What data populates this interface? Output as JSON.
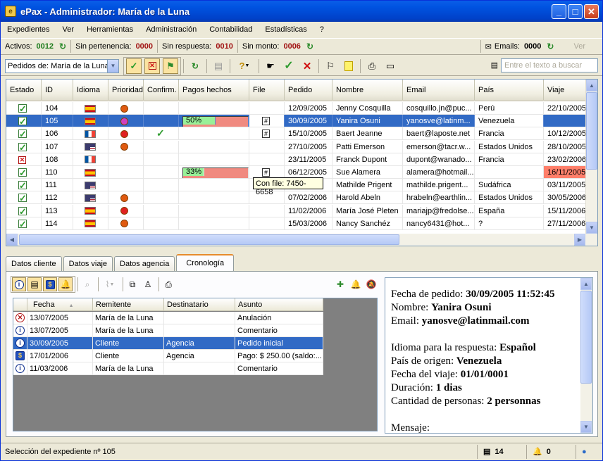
{
  "window": {
    "title": "ePax - Administrador: María de la Luna"
  },
  "menu": [
    "Expedientes",
    "Ver",
    "Herramientas",
    "Administración",
    "Contabilidad",
    "Estadísticas",
    "?"
  ],
  "counters": {
    "activos_label": "Activos:",
    "activos_value": "0012",
    "sin_pertenencia_label": "Sin pertenencia:",
    "sin_pertenencia_value": "0000",
    "sin_respuesta_label": "Sin respuesta:",
    "sin_respuesta_value": "0010",
    "sin_monto_label": "Sin monto:",
    "sin_monto_value": "0006",
    "emails_label": "Emails:",
    "emails_value": "0000",
    "ver_label": "Ver"
  },
  "toolbar": {
    "pedidos_select": "Pedidos de: María de la Luna",
    "search_placeholder": "Entre el texto a buscar"
  },
  "grid": {
    "columns": [
      "Estado",
      "ID",
      "Idioma",
      "Prioridad",
      "Confirm.",
      "Pagos hechos",
      "File",
      "Pedido",
      "Nombre",
      "Email",
      "País",
      "Viaje"
    ],
    "rows": [
      {
        "estado": "ok",
        "id": "104",
        "lang": "es",
        "prio": "a",
        "confirm": false,
        "pago": null,
        "file": false,
        "pedido": "12/09/2005",
        "nombre": "Jenny Cosquilla",
        "email": "cosquillo.jn@puc...",
        "pais": "Perú",
        "viaje": "22/10/2005"
      },
      {
        "estado": "ok",
        "id": "105",
        "lang": "es",
        "prio": "b",
        "confirm": false,
        "pago": 0.5,
        "pago_label": "50%",
        "file": true,
        "pedido": "30/09/2005",
        "nombre": "Yanira Osuni",
        "email": "yanosve@latinm...",
        "pais": "Venezuela",
        "viaje": ""
      },
      {
        "estado": "ok",
        "id": "106",
        "lang": "fr",
        "prio": "c",
        "confirm": true,
        "pago": null,
        "file": true,
        "pedido": "15/10/2005",
        "nombre": "Baert Jeanne",
        "email": "baert@laposte.net",
        "pais": "Francia",
        "viaje": "10/12/2005"
      },
      {
        "estado": "ok",
        "id": "107",
        "lang": "us",
        "prio": "a",
        "confirm": false,
        "pago": null,
        "file": false,
        "pedido": "27/10/2005",
        "nombre": "Patti Emerson",
        "email": "emerson@tacr.w...",
        "pais": "Estados Unidos",
        "viaje": "28/10/2005"
      },
      {
        "estado": "x",
        "id": "108",
        "lang": "fr",
        "prio": "",
        "confirm": false,
        "pago": null,
        "file": false,
        "pedido": "23/11/2005",
        "nombre": "Franck Dupont",
        "email": "dupont@wanado...",
        "pais": "Francia",
        "viaje": "23/02/2006"
      },
      {
        "estado": "ok",
        "id": "110",
        "lang": "es",
        "prio": "",
        "confirm": false,
        "pago": 0.33,
        "pago_label": "33%",
        "file": true,
        "pedido": "06/12/2005",
        "nombre": "Sue Alamera",
        "email": "alamera@hotmail...",
        "pais": "",
        "viaje": "16/11/2005",
        "viaje_hl": true
      },
      {
        "estado": "ok",
        "id": "111",
        "lang": "us",
        "prio": "",
        "confirm": false,
        "pago": null,
        "file": false,
        "pedido": "",
        "nombre": "Mathilde Prigent",
        "email": "mathilde.prigent...",
        "pais": "Sudáfrica",
        "viaje": "03/11/2005"
      },
      {
        "estado": "ok",
        "id": "112",
        "lang": "us",
        "prio": "a",
        "confirm": false,
        "pago": null,
        "file": false,
        "pedido": "07/02/2006",
        "nombre": "Harold Abeln",
        "email": "hrabeln@earthlin...",
        "pais": "Estados Unidos",
        "viaje": "30/05/2006"
      },
      {
        "estado": "ok",
        "id": "113",
        "lang": "es",
        "prio": "c",
        "confirm": false,
        "pago": null,
        "file": false,
        "pedido": "11/02/2006",
        "nombre": "María José Pleten",
        "email": "mariajp@fredolse...",
        "pais": "España",
        "viaje": "15/11/2006"
      },
      {
        "estado": "ok",
        "id": "114",
        "lang": "es",
        "prio": "a",
        "confirm": false,
        "pago": null,
        "file": false,
        "pedido": "15/03/2006",
        "nombre": "Nancy Sanchéz",
        "email": "nancy6431@hot...",
        "pais": "?",
        "viaje": "27/11/2006"
      }
    ],
    "tooltip": "Con file: 7450-6658"
  },
  "tabs": [
    "Datos cliente",
    "Datos viaje",
    "Datos agencia",
    "Cronología"
  ],
  "chrono": {
    "columns": [
      "Fecha",
      "Remitente",
      "Destinatario",
      "Asunto"
    ],
    "rows": [
      {
        "icon": "x",
        "fecha": "13/07/2005",
        "remitente": "María de la Luna",
        "destinatario": "",
        "asunto": "Anulación"
      },
      {
        "icon": "i",
        "fecha": "13/07/2005",
        "remitente": "María de la Luna",
        "destinatario": "",
        "asunto": "Comentario"
      },
      {
        "icon": "i",
        "fecha": "30/09/2005",
        "remitente": "Cliente",
        "destinatario": "Agencia",
        "asunto": "Pedido inicial",
        "sel": true
      },
      {
        "icon": "d",
        "fecha": "17/01/2006",
        "remitente": "Cliente",
        "destinatario": "Agencia",
        "asunto": "Pago: $ 250.00 (saldo:..."
      },
      {
        "icon": "i",
        "fecha": "11/03/2006",
        "remitente": "María de la Luna",
        "destinatario": "",
        "asunto": "Comentario"
      }
    ]
  },
  "detail": {
    "lines": [
      {
        "label": "Fecha de pedido: ",
        "value": "30/09/2005 11:52:45"
      },
      {
        "label": "Nombre: ",
        "value": "Yanira Osuni"
      },
      {
        "label": "Email: ",
        "value": "yanosve@latinmail.com"
      },
      {
        "label": "",
        "value": ""
      },
      {
        "label": "Idioma para la respuesta: ",
        "value": "Español"
      },
      {
        "label": "País de origen: ",
        "value": "Venezuela"
      },
      {
        "label": "Fecha del viaje: ",
        "value": "01/01/0001"
      },
      {
        "label": "Duración: ",
        "value": "1 dias"
      },
      {
        "label": "Cantidad de personas: ",
        "value": "2 personnas"
      },
      {
        "label": "",
        "value": ""
      },
      {
        "label": "Mensaje:",
        "value": ""
      }
    ]
  },
  "status": {
    "text": "Selección del expediente nº 105",
    "docs": "14",
    "alerts": "0"
  }
}
